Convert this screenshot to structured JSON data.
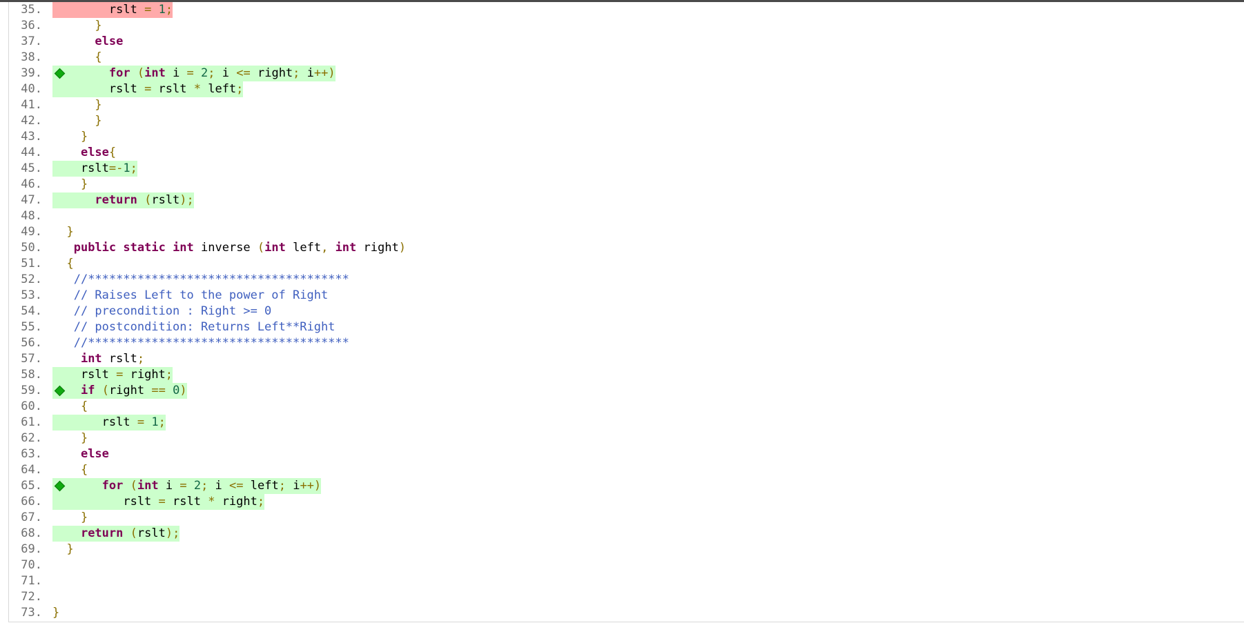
{
  "viewer": {
    "lines": [
      {
        "num": "35.",
        "hl": "red",
        "diamond": false,
        "tokens": [
          {
            "t": "        rslt ",
            "c": "id"
          },
          {
            "t": "=",
            "c": "op"
          },
          {
            "t": " ",
            "c": "id"
          },
          {
            "t": "1",
            "c": "num"
          },
          {
            "t": ";",
            "c": "op"
          }
        ]
      },
      {
        "num": "36.",
        "hl": "",
        "diamond": false,
        "tokens": [
          {
            "t": "      ",
            "c": "id"
          },
          {
            "t": "}",
            "c": "op"
          }
        ]
      },
      {
        "num": "37.",
        "hl": "",
        "diamond": false,
        "tokens": [
          {
            "t": "      ",
            "c": "id"
          },
          {
            "t": "else",
            "c": "kw"
          }
        ]
      },
      {
        "num": "38.",
        "hl": "",
        "diamond": false,
        "tokens": [
          {
            "t": "      ",
            "c": "id"
          },
          {
            "t": "{",
            "c": "op"
          }
        ]
      },
      {
        "num": "39.",
        "hl": "green",
        "diamond": true,
        "tokens": [
          {
            "t": "        ",
            "c": "id"
          },
          {
            "t": "for",
            "c": "kw"
          },
          {
            "t": " ",
            "c": "id"
          },
          {
            "t": "(",
            "c": "op"
          },
          {
            "t": "int",
            "c": "kw"
          },
          {
            "t": " i ",
            "c": "id"
          },
          {
            "t": "=",
            "c": "op"
          },
          {
            "t": " ",
            "c": "id"
          },
          {
            "t": "2",
            "c": "num"
          },
          {
            "t": ";",
            "c": "op"
          },
          {
            "t": " i ",
            "c": "id"
          },
          {
            "t": "<=",
            "c": "op"
          },
          {
            "t": " right",
            "c": "id"
          },
          {
            "t": ";",
            "c": "op"
          },
          {
            "t": " i",
            "c": "id"
          },
          {
            "t": "++)",
            "c": "op"
          }
        ]
      },
      {
        "num": "40.",
        "hl": "green",
        "diamond": false,
        "tokens": [
          {
            "t": "        rslt ",
            "c": "id"
          },
          {
            "t": "=",
            "c": "op"
          },
          {
            "t": " rslt ",
            "c": "id"
          },
          {
            "t": "*",
            "c": "op"
          },
          {
            "t": " left",
            "c": "id"
          },
          {
            "t": ";",
            "c": "op"
          }
        ]
      },
      {
        "num": "41.",
        "hl": "",
        "diamond": false,
        "tokens": [
          {
            "t": "      ",
            "c": "id"
          },
          {
            "t": "}",
            "c": "op"
          }
        ]
      },
      {
        "num": "42.",
        "hl": "",
        "diamond": false,
        "tokens": [
          {
            "t": "      ",
            "c": "id"
          },
          {
            "t": "}",
            "c": "op"
          }
        ]
      },
      {
        "num": "43.",
        "hl": "",
        "diamond": false,
        "tokens": [
          {
            "t": "    ",
            "c": "id"
          },
          {
            "t": "}",
            "c": "op"
          }
        ]
      },
      {
        "num": "44.",
        "hl": "",
        "diamond": false,
        "tokens": [
          {
            "t": "    ",
            "c": "id"
          },
          {
            "t": "else",
            "c": "kw"
          },
          {
            "t": "{",
            "c": "op"
          }
        ]
      },
      {
        "num": "45.",
        "hl": "green",
        "diamond": false,
        "tokens": [
          {
            "t": "    rslt",
            "c": "id"
          },
          {
            "t": "=-",
            "c": "op"
          },
          {
            "t": "1",
            "c": "num"
          },
          {
            "t": ";",
            "c": "op"
          }
        ]
      },
      {
        "num": "46.",
        "hl": "",
        "diamond": false,
        "tokens": [
          {
            "t": "    ",
            "c": "id"
          },
          {
            "t": "}",
            "c": "op"
          }
        ]
      },
      {
        "num": "47.",
        "hl": "green",
        "diamond": false,
        "tokens": [
          {
            "t": "      ",
            "c": "id"
          },
          {
            "t": "return",
            "c": "kw"
          },
          {
            "t": " ",
            "c": "id"
          },
          {
            "t": "(",
            "c": "op"
          },
          {
            "t": "rslt",
            "c": "id"
          },
          {
            "t": ");",
            "c": "op"
          }
        ]
      },
      {
        "num": "48.",
        "hl": "",
        "diamond": false,
        "tokens": []
      },
      {
        "num": "49.",
        "hl": "",
        "diamond": false,
        "tokens": [
          {
            "t": "  ",
            "c": "id"
          },
          {
            "t": "}",
            "c": "op"
          }
        ]
      },
      {
        "num": "50.",
        "hl": "",
        "diamond": false,
        "tokens": [
          {
            "t": "   ",
            "c": "id"
          },
          {
            "t": "public",
            "c": "kw"
          },
          {
            "t": " ",
            "c": "id"
          },
          {
            "t": "static",
            "c": "kw"
          },
          {
            "t": " ",
            "c": "id"
          },
          {
            "t": "int",
            "c": "kw"
          },
          {
            "t": " inverse ",
            "c": "id"
          },
          {
            "t": "(",
            "c": "op"
          },
          {
            "t": "int",
            "c": "kw"
          },
          {
            "t": " left",
            "c": "id"
          },
          {
            "t": ",",
            "c": "op"
          },
          {
            "t": " ",
            "c": "id"
          },
          {
            "t": "int",
            "c": "kw"
          },
          {
            "t": " right",
            "c": "id"
          },
          {
            "t": ")",
            "c": "op"
          }
        ]
      },
      {
        "num": "51.",
        "hl": "",
        "diamond": false,
        "tokens": [
          {
            "t": "  ",
            "c": "id"
          },
          {
            "t": "{",
            "c": "op"
          }
        ]
      },
      {
        "num": "52.",
        "hl": "",
        "diamond": false,
        "tokens": [
          {
            "t": "   ",
            "c": "id"
          },
          {
            "t": "//*************************************",
            "c": "cm"
          }
        ]
      },
      {
        "num": "53.",
        "hl": "",
        "diamond": false,
        "tokens": [
          {
            "t": "   ",
            "c": "id"
          },
          {
            "t": "// Raises Left to the power of Right",
            "c": "cm"
          }
        ]
      },
      {
        "num": "54.",
        "hl": "",
        "diamond": false,
        "tokens": [
          {
            "t": "   ",
            "c": "id"
          },
          {
            "t": "// precondition : Right >= 0",
            "c": "cm"
          }
        ]
      },
      {
        "num": "55.",
        "hl": "",
        "diamond": false,
        "tokens": [
          {
            "t": "   ",
            "c": "id"
          },
          {
            "t": "// postcondition: Returns Left**Right",
            "c": "cm"
          }
        ]
      },
      {
        "num": "56.",
        "hl": "",
        "diamond": false,
        "tokens": [
          {
            "t": "   ",
            "c": "id"
          },
          {
            "t": "//*************************************",
            "c": "cm"
          }
        ]
      },
      {
        "num": "57.",
        "hl": "",
        "diamond": false,
        "tokens": [
          {
            "t": "    ",
            "c": "id"
          },
          {
            "t": "int",
            "c": "kw"
          },
          {
            "t": " rslt",
            "c": "id"
          },
          {
            "t": ";",
            "c": "op"
          }
        ]
      },
      {
        "num": "58.",
        "hl": "green",
        "diamond": false,
        "tokens": [
          {
            "t": "    rslt ",
            "c": "id"
          },
          {
            "t": "=",
            "c": "op"
          },
          {
            "t": " right",
            "c": "id"
          },
          {
            "t": ";",
            "c": "op"
          }
        ]
      },
      {
        "num": "59.",
        "hl": "green",
        "diamond": true,
        "tokens": [
          {
            "t": "    ",
            "c": "id"
          },
          {
            "t": "if",
            "c": "kw"
          },
          {
            "t": " ",
            "c": "id"
          },
          {
            "t": "(",
            "c": "op"
          },
          {
            "t": "right ",
            "c": "id"
          },
          {
            "t": "==",
            "c": "op"
          },
          {
            "t": " ",
            "c": "id"
          },
          {
            "t": "0",
            "c": "num"
          },
          {
            "t": ")",
            "c": "op"
          }
        ]
      },
      {
        "num": "60.",
        "hl": "",
        "diamond": false,
        "tokens": [
          {
            "t": "    ",
            "c": "id"
          },
          {
            "t": "{",
            "c": "op"
          }
        ]
      },
      {
        "num": "61.",
        "hl": "green",
        "diamond": false,
        "tokens": [
          {
            "t": "       rslt ",
            "c": "id"
          },
          {
            "t": "=",
            "c": "op"
          },
          {
            "t": " ",
            "c": "id"
          },
          {
            "t": "1",
            "c": "num"
          },
          {
            "t": ";",
            "c": "op"
          }
        ]
      },
      {
        "num": "62.",
        "hl": "",
        "diamond": false,
        "tokens": [
          {
            "t": "    ",
            "c": "id"
          },
          {
            "t": "}",
            "c": "op"
          }
        ]
      },
      {
        "num": "63.",
        "hl": "",
        "diamond": false,
        "tokens": [
          {
            "t": "    ",
            "c": "id"
          },
          {
            "t": "else",
            "c": "kw"
          }
        ]
      },
      {
        "num": "64.",
        "hl": "",
        "diamond": false,
        "tokens": [
          {
            "t": "    ",
            "c": "id"
          },
          {
            "t": "{",
            "c": "op"
          }
        ]
      },
      {
        "num": "65.",
        "hl": "green",
        "diamond": true,
        "tokens": [
          {
            "t": "       ",
            "c": "id"
          },
          {
            "t": "for",
            "c": "kw"
          },
          {
            "t": " ",
            "c": "id"
          },
          {
            "t": "(",
            "c": "op"
          },
          {
            "t": "int",
            "c": "kw"
          },
          {
            "t": " i ",
            "c": "id"
          },
          {
            "t": "=",
            "c": "op"
          },
          {
            "t": " ",
            "c": "id"
          },
          {
            "t": "2",
            "c": "num"
          },
          {
            "t": ";",
            "c": "op"
          },
          {
            "t": " i ",
            "c": "id"
          },
          {
            "t": "<=",
            "c": "op"
          },
          {
            "t": " left",
            "c": "id"
          },
          {
            "t": ";",
            "c": "op"
          },
          {
            "t": " i",
            "c": "id"
          },
          {
            "t": "++)",
            "c": "op"
          }
        ]
      },
      {
        "num": "66.",
        "hl": "green",
        "diamond": false,
        "tokens": [
          {
            "t": "          rslt ",
            "c": "id"
          },
          {
            "t": "=",
            "c": "op"
          },
          {
            "t": " rslt ",
            "c": "id"
          },
          {
            "t": "*",
            "c": "op"
          },
          {
            "t": " right",
            "c": "id"
          },
          {
            "t": ";",
            "c": "op"
          }
        ]
      },
      {
        "num": "67.",
        "hl": "",
        "diamond": false,
        "tokens": [
          {
            "t": "    ",
            "c": "id"
          },
          {
            "t": "}",
            "c": "op"
          }
        ]
      },
      {
        "num": "68.",
        "hl": "green",
        "diamond": false,
        "tokens": [
          {
            "t": "    ",
            "c": "id"
          },
          {
            "t": "return",
            "c": "kw"
          },
          {
            "t": " ",
            "c": "id"
          },
          {
            "t": "(",
            "c": "op"
          },
          {
            "t": "rslt",
            "c": "id"
          },
          {
            "t": ");",
            "c": "op"
          }
        ]
      },
      {
        "num": "69.",
        "hl": "",
        "diamond": false,
        "tokens": [
          {
            "t": "  ",
            "c": "id"
          },
          {
            "t": "}",
            "c": "op"
          }
        ]
      },
      {
        "num": "70.",
        "hl": "",
        "diamond": false,
        "tokens": []
      },
      {
        "num": "71.",
        "hl": "",
        "diamond": false,
        "tokens": []
      },
      {
        "num": "72.",
        "hl": "",
        "diamond": false,
        "tokens": []
      },
      {
        "num": "73.",
        "hl": "",
        "diamond": false,
        "tokens": [
          {
            "t": "}",
            "c": "op"
          }
        ]
      }
    ],
    "marker_icon": "coverage-diamond-icon",
    "colors": {
      "not_covered": "#ffaaaa",
      "covered": "#ccffcc",
      "marker": "#11aa11"
    }
  }
}
